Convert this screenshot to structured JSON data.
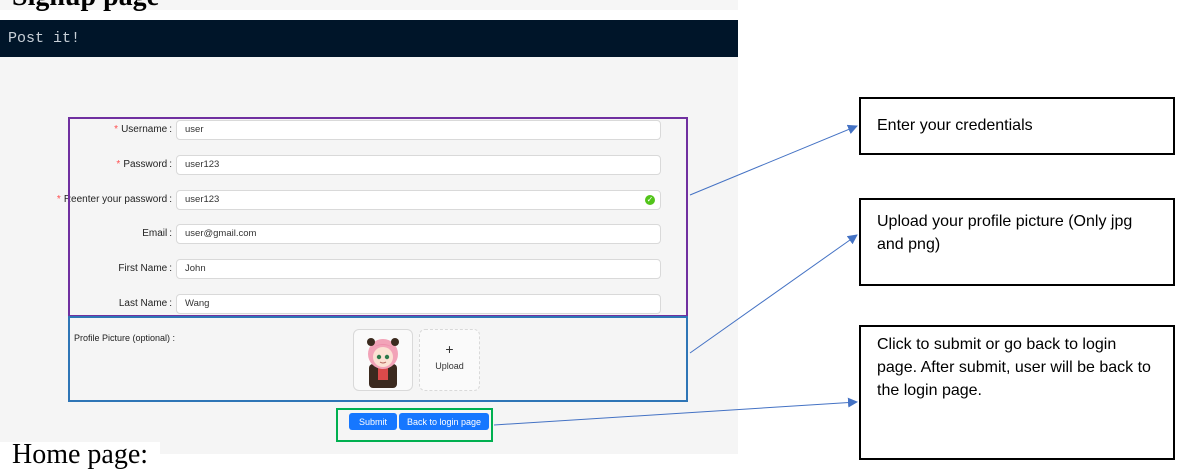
{
  "document": {
    "section_heading": "Signup page",
    "next_heading": "Home page:"
  },
  "app": {
    "title": "Post it!",
    "colors": {
      "topbar": "#001529",
      "primary": "#1677ff",
      "required": "#ff4d4f",
      "success": "#52c41a"
    }
  },
  "form": {
    "fields": [
      {
        "label": "Username",
        "required": true,
        "value": "user"
      },
      {
        "label": "Password",
        "required": true,
        "value": "user123"
      },
      {
        "label": "Reenter your password",
        "required": true,
        "value": "user123",
        "status": "check-circle-icon"
      },
      {
        "label": "Email",
        "required": false,
        "value": "user@gmail.com"
      },
      {
        "label": "First Name",
        "required": false,
        "value": "John"
      },
      {
        "label": "Last Name",
        "required": false,
        "value": "Wang"
      }
    ],
    "colon": ":",
    "required_mark": "*",
    "profile_picture": {
      "label": "Profile Picture (optional) :",
      "thumbnail_icon": "avatar-thumbnail",
      "upload_plus": "+",
      "upload_label": "Upload"
    },
    "buttons": {
      "submit": "Submit",
      "back": "Back to login page"
    }
  },
  "annotations": {
    "credentials": "Enter your credentials",
    "upload": "Upload your profile picture (Only jpg and png)",
    "submit": "Click to submit or go back to login page. After submit, user will be back to the login page.",
    "colors": {
      "credentials_box": "#7030a0",
      "upload_box": "#2e75b6",
      "buttons_box": "#00b050",
      "arrow": "#4472c4"
    }
  }
}
